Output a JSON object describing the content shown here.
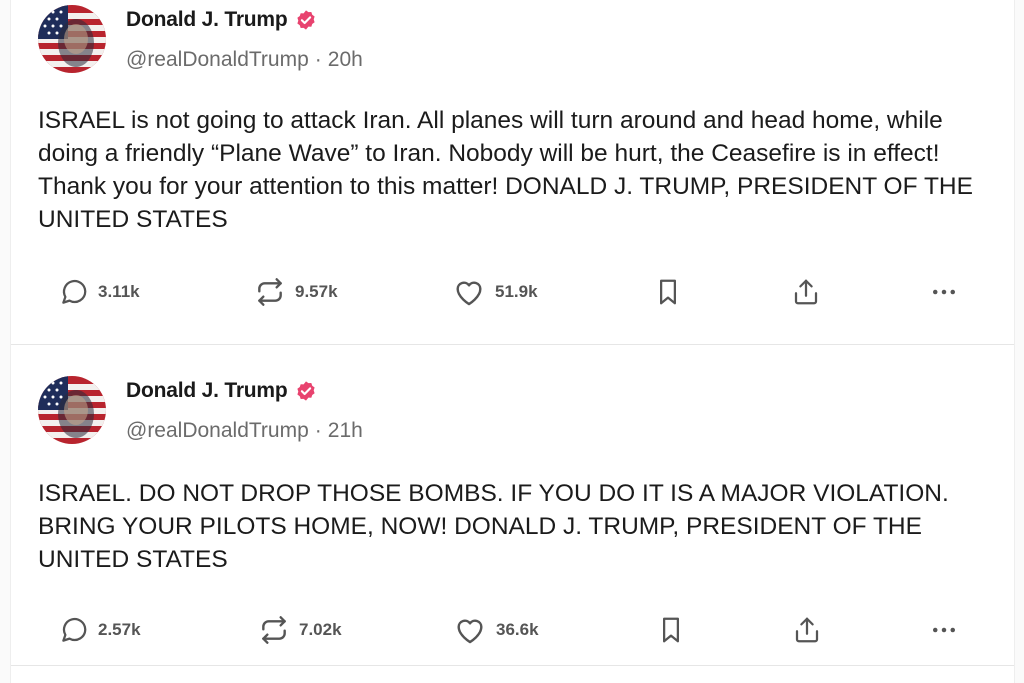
{
  "posts": [
    {
      "author": {
        "display_name": "Donald J. Trump",
        "handle": "@realDonaldTrump",
        "verified": true
      },
      "age": "20h",
      "separator": "·",
      "text": "ISRAEL is not going to attack Iran. All planes will turn around and head home, while doing a friendly “Plane Wave” to Iran. Nobody will be hurt, the Ceasefire is in effect! Thank you for your attention to this matter! DONALD J. TRUMP, PRESIDENT OF THE UNITED STATES",
      "stats": {
        "replies": "3.11k",
        "reposts": "9.57k",
        "likes": "51.9k"
      }
    },
    {
      "author": {
        "display_name": "Donald J. Trump",
        "handle": "@realDonaldTrump",
        "verified": true
      },
      "age": "21h",
      "separator": "·",
      "text": "ISRAEL. DO NOT DROP THOSE BOMBS. IF YOU DO IT IS A MAJOR VIOLATION. BRING YOUR PILOTS HOME, NOW!  DONALD J. TRUMP, PRESIDENT OF THE UNITED STATES",
      "stats": {
        "replies": "2.57k",
        "reposts": "7.02k",
        "likes": "36.6k"
      }
    }
  ],
  "icons": {
    "verified": "verified-badge-icon",
    "reply": "comment-icon",
    "repost": "repost-icon",
    "like": "heart-icon",
    "bookmark": "bookmark-icon",
    "share": "share-icon",
    "more": "more-dots-icon"
  },
  "colors": {
    "verified_badge": "#e8436f",
    "icon_gray": "#555555",
    "handle_gray": "#6b6b6b",
    "text": "#1b1b1b"
  }
}
